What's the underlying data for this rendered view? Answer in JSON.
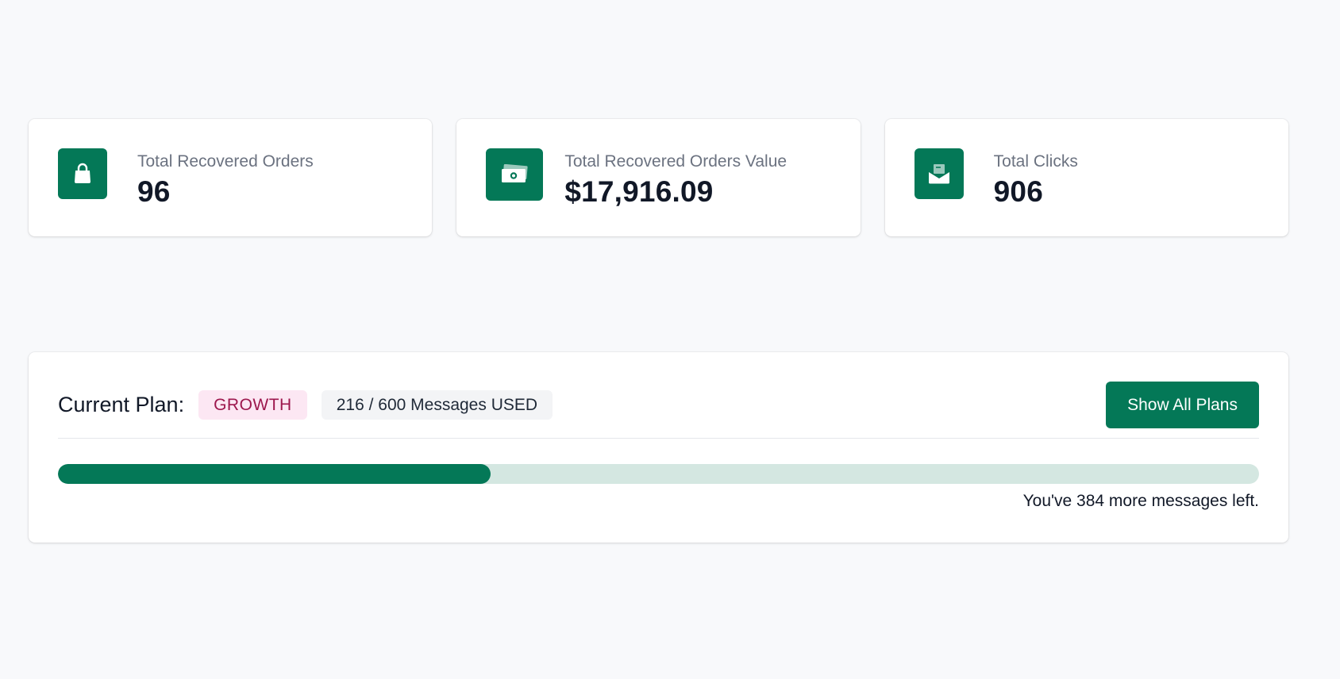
{
  "stats": [
    {
      "label": "Total Recovered Orders",
      "value": "96",
      "icon": "shopping-bag-icon"
    },
    {
      "label": "Total Recovered Orders Value",
      "value": "$17,916.09",
      "icon": "money-icon"
    },
    {
      "label": "Total Clicks",
      "value": "906",
      "icon": "envelope-icon"
    }
  ],
  "plan": {
    "title": "Current Plan:",
    "name": "GROWTH",
    "usage": "216 / 600 Messages USED",
    "used": 216,
    "total": 600,
    "button_label": "Show All Plans",
    "remaining_text": "You've 384 more messages left."
  },
  "colors": {
    "accent": "#047857",
    "progress_track": "#d4e7e1",
    "plan_badge_bg": "#fce7f3",
    "plan_badge_text": "#9d174d",
    "page_bg": "#f8f9fb"
  }
}
